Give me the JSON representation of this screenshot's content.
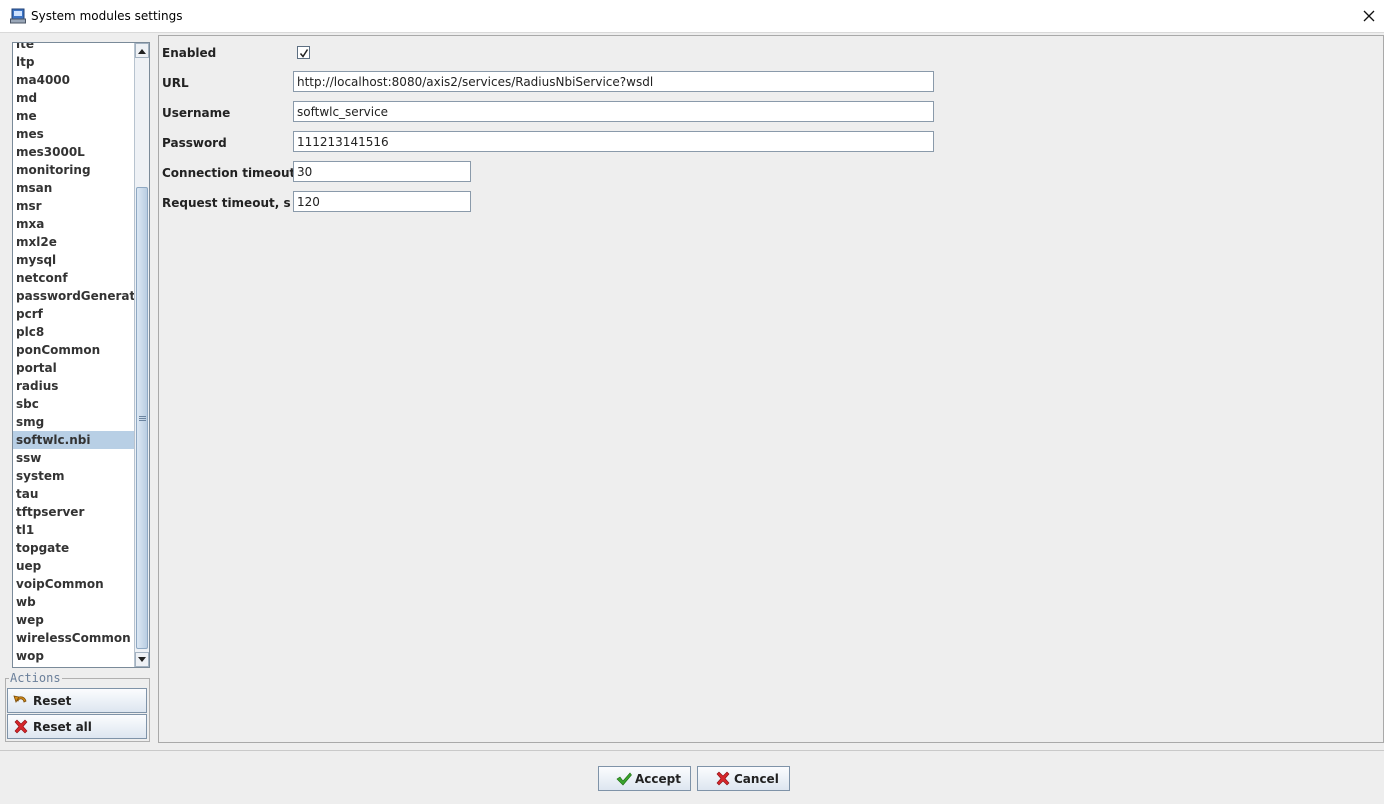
{
  "window": {
    "title": "System modules settings"
  },
  "modules": {
    "items": [
      "lte",
      "ltp",
      "ma4000",
      "md",
      "me",
      "mes",
      "mes3000L",
      "monitoring",
      "msan",
      "msr",
      "mxa",
      "mxl2e",
      "mysql",
      "netconf",
      "passwordGenerator",
      "pcrf",
      "plc8",
      "ponCommon",
      "portal",
      "radius",
      "sbc",
      "smg",
      "softwlc.nbi",
      "ssw",
      "system",
      "tau",
      "tftpserver",
      "tl1",
      "topgate",
      "uep",
      "voipCommon",
      "wb",
      "wep",
      "wirelessCommon",
      "wop"
    ],
    "selected": "softwlc.nbi"
  },
  "actions": {
    "legend": "Actions",
    "reset_label": "Reset",
    "reset_all_label": "Reset all"
  },
  "form": {
    "enabled_label": "Enabled",
    "enabled": true,
    "url_label": "URL",
    "url_value": "http://localhost:8080/axis2/services/RadiusNbiService?wsdl",
    "username_label": "Username",
    "username_value": "softwlc_service",
    "password_label": "Password",
    "password_value": "111213141516",
    "connection_timeout_label": "Connection timeout, s",
    "connection_timeout_value": "30",
    "request_timeout_label": "Request timeout, s",
    "request_timeout_value": "120"
  },
  "dialog": {
    "accept_label": "Accept",
    "cancel_label": "Cancel"
  },
  "colors": {
    "selection": "#b8cfe5",
    "accept_icon": "#3aa52c",
    "cancel_icon": "#d6262b",
    "reset_icon": "#d08a1a"
  }
}
